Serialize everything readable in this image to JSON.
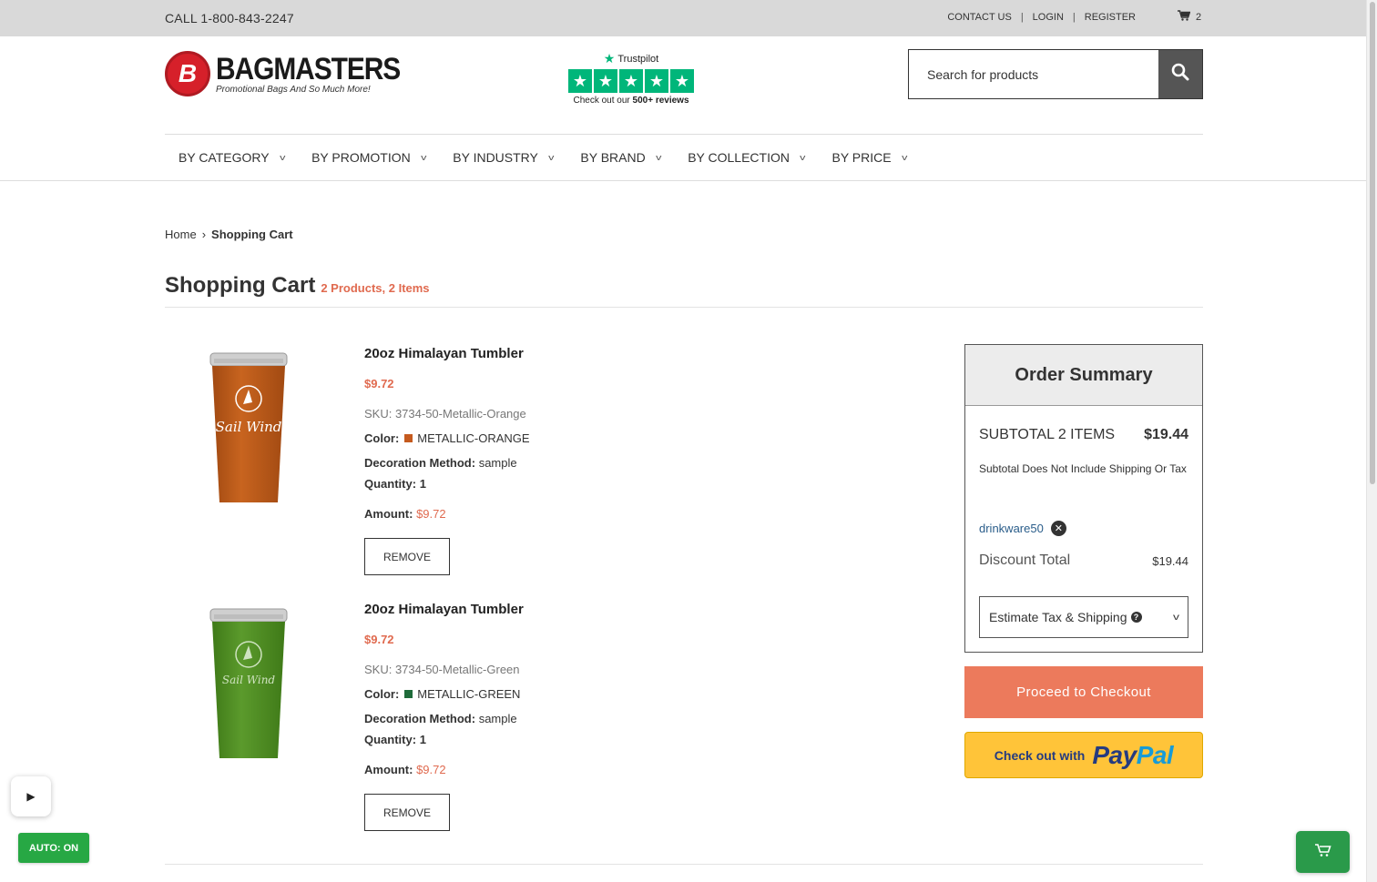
{
  "topbar": {
    "phone": "CALL 1-800-843-2247",
    "contact": "CONTACT US",
    "login": "LOGIN",
    "register": "REGISTER",
    "cart_count": "2"
  },
  "logo": {
    "name": "BAGMASTERS",
    "tagline": "Promotional Bags And So Much More!",
    "badge_letter": "B"
  },
  "trustpilot": {
    "brand": "Trustpilot",
    "reviews_prefix": "Check out our ",
    "reviews_count": "500+ reviews"
  },
  "search": {
    "placeholder": "Search for products"
  },
  "nav": [
    {
      "label": "BY CATEGORY"
    },
    {
      "label": "BY PROMOTION"
    },
    {
      "label": "BY INDUSTRY"
    },
    {
      "label": "BY BRAND"
    },
    {
      "label": "BY COLLECTION"
    },
    {
      "label": "BY PRICE"
    }
  ],
  "breadcrumb": {
    "home": "Home",
    "current": "Shopping Cart"
  },
  "page": {
    "title": "Shopping Cart",
    "count": "2 Products, 2 Items"
  },
  "labels": {
    "color": "Color:",
    "decoration": "Decoration Method:",
    "quantity": "Quantity:",
    "amount": "Amount:",
    "remove": "REMOVE"
  },
  "products": [
    {
      "name": "20oz Himalayan Tumbler",
      "price": "$9.72",
      "sku": "SKU: 3734-50-Metallic-Orange",
      "color": "METALLIC-ORANGE",
      "swatch": "#c55a1e",
      "decoration": "sample",
      "quantity": "1",
      "amount": "$9.72",
      "tumbler_color": "#c8641f",
      "tumbler_shade": "#a24a12",
      "imprint": "Sail Wind"
    },
    {
      "name": "20oz Himalayan Tumbler",
      "price": "$9.72",
      "sku": "SKU: 3734-50-Metallic-Green",
      "color": "METALLIC-GREEN",
      "swatch": "#1f6b3a",
      "decoration": "sample",
      "quantity": "1",
      "amount": "$9.72",
      "tumbler_color": "#5b9a2c",
      "tumbler_shade": "#3f7a18",
      "imprint": "Sail Wind"
    }
  ],
  "summary": {
    "title": "Order Summary",
    "subtotal_label": "SUBTOTAL 2 ITEMS",
    "subtotal_value": "$19.44",
    "note": "Subtotal Does Not Include Shipping Or Tax",
    "coupon": "drinkware50",
    "discount_label": "Discount Total",
    "discount_value": "$19.44",
    "estimate": "Estimate Tax & Shipping"
  },
  "checkout": {
    "label": "Proceed to Checkout"
  },
  "paypal": {
    "prefix": "Check out with",
    "brand_a": "Pay",
    "brand_b": "Pal"
  },
  "widgets": {
    "auto": "AUTO: ON"
  },
  "colors": {
    "accent": "#e06a4f",
    "checkout": "#ec7a5c",
    "paypal": "#ffc439",
    "trustpilot": "#00b67a",
    "green_btn": "#27a844"
  }
}
